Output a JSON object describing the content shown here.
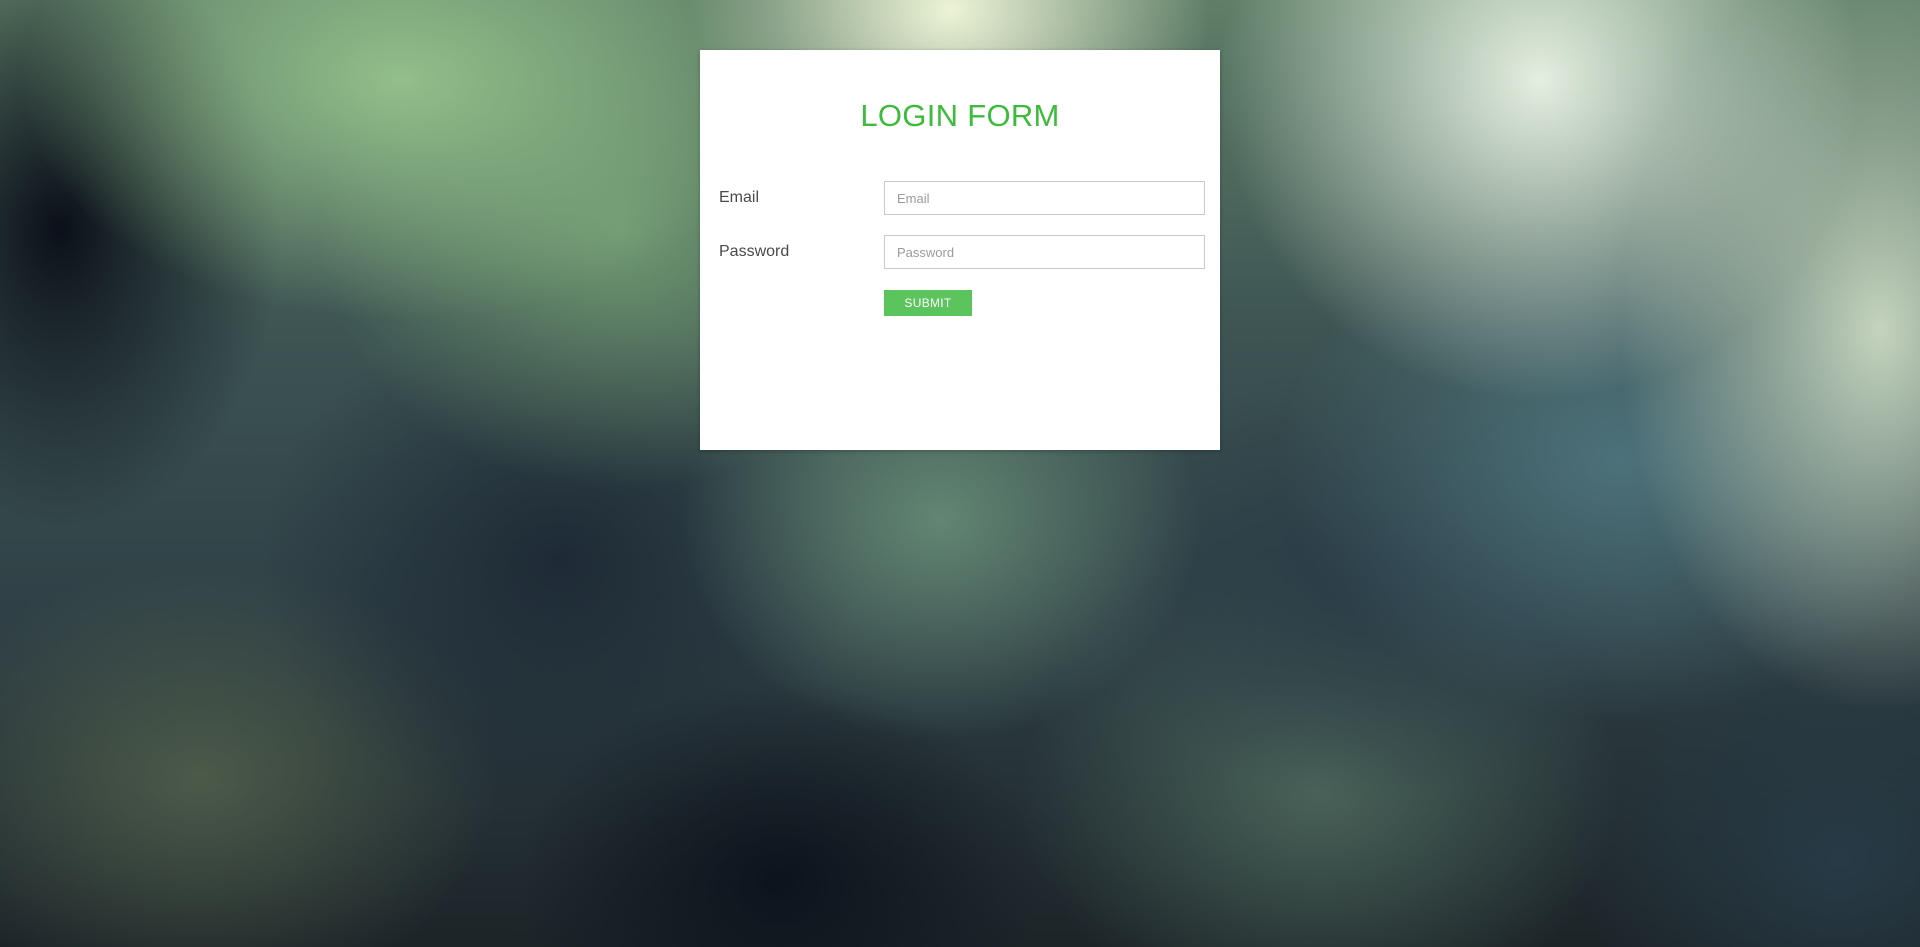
{
  "form": {
    "title": "LOGIN FORM",
    "title_color": "#3dbb3d",
    "email": {
      "label": "Email",
      "placeholder": "Email",
      "value": ""
    },
    "password": {
      "label": "Password",
      "placeholder": "Password",
      "value": ""
    },
    "submit_label": "SUBMIT",
    "submit_color": "#5cc45c"
  }
}
